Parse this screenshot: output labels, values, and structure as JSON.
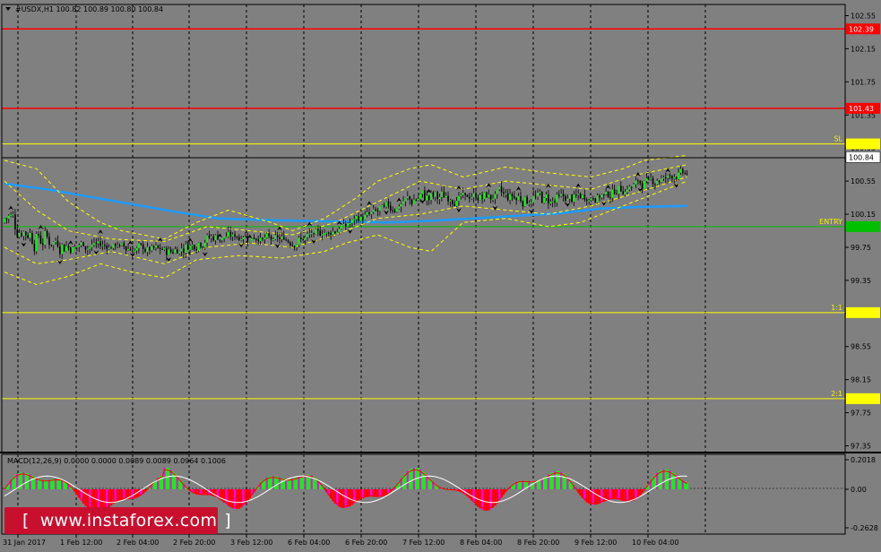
{
  "window": {
    "symbol_title": "#USDX,H1  100.82 100.89 100.80 100.84",
    "macd_title": "MACD(12,26,9) 0.0000 0.0000 0.0089 0.0089 0.0964 0.1006"
  },
  "watermark": {
    "open": "[",
    "text": "www.instaforex.com",
    "close": "]"
  },
  "colors": {
    "background": "#808080",
    "grid": "#000000",
    "bull_candle": "#00ff00",
    "bear_candle": "#000000",
    "ma": "#1e9bff",
    "envelope": "#ffff00",
    "resistance": "#ff0000",
    "level": "#ffff00",
    "entry": "#00c000",
    "macd_line": "#ff0000",
    "signal_line": "#ffffff",
    "hist_up": "#00ff00",
    "hist_down": "#ff0000",
    "hist_mid": "#ff00ff"
  },
  "chart_data": [
    {
      "type": "candlestick",
      "title": "#USDX,H1  100.82 100.89 100.80 100.84",
      "symbol": "#USDX",
      "timeframe": "H1",
      "ohlc_last": {
        "open": 100.82,
        "high": 100.89,
        "low": 100.8,
        "close": 100.84
      },
      "y_ticks": [
        102.55,
        102.15,
        101.75,
        101.35,
        100.95,
        100.55,
        100.15,
        99.75,
        99.35,
        98.95,
        98.55,
        98.15,
        97.75,
        97.35
      ],
      "x_ticks": [
        "31 Jan 2017",
        "1 Feb 12:00",
        "2 Feb 04:00",
        "2 Feb 20:00",
        "3 Feb 12:00",
        "6 Feb 04:00",
        "6 Feb 20:00",
        "7 Feb 12:00",
        "8 Feb 04:00",
        "8 Feb 20:00",
        "9 Feb 12:00",
        "10 Feb 04:00"
      ],
      "ylim": [
        97.25,
        102.65
      ],
      "grid": true,
      "levels": [
        {
          "name": "r2",
          "value": 102.39,
          "label": "",
          "badge": "102.39",
          "color": "#ff0000"
        },
        {
          "name": "r1",
          "value": 101.43,
          "label": "",
          "badge": "101.43",
          "color": "#ff0000"
        },
        {
          "name": "sl",
          "value": 101.0,
          "label": "SL",
          "badge": "",
          "color": "#ffff00"
        },
        {
          "name": "entry",
          "value": 100.0,
          "label": "ENTRY",
          "badge": "",
          "color": "#00c000"
        },
        {
          "name": "tp1",
          "value": 98.96,
          "label": "1:1",
          "badge": "",
          "color": "#ffff00"
        },
        {
          "name": "tp2",
          "value": 97.92,
          "label": "2:1",
          "badge": "",
          "color": "#ffff00"
        }
      ],
      "current_price": {
        "value": 100.84,
        "badge": "100.84"
      },
      "series": [
        {
          "kind": "moving_average",
          "points": [
            [
              0,
              100.52
            ],
            [
              20,
              100.45
            ],
            [
              40,
              100.36
            ],
            [
              60,
              100.27
            ],
            [
              80,
              100.18
            ],
            [
              100,
              100.1
            ],
            [
              120,
              100.08
            ],
            [
              140,
              100.07
            ],
            [
              160,
              100.06
            ],
            [
              180,
              100.05
            ],
            [
              200,
              100.07
            ],
            [
              220,
              100.1
            ],
            [
              240,
              100.13
            ],
            [
              260,
              100.16
            ],
            [
              280,
              100.22
            ],
            [
              300,
              100.24
            ],
            [
              320,
              100.25
            ]
          ]
        },
        {
          "kind": "envelope_upper",
          "points": [
            [
              0,
              100.8
            ],
            [
              15,
              100.7
            ],
            [
              30,
              100.3
            ],
            [
              45,
              100.05
            ],
            [
              55,
              99.95
            ],
            [
              75,
              99.85
            ],
            [
              90,
              100.05
            ],
            [
              105,
              100.2
            ],
            [
              125,
              100.05
            ],
            [
              135,
              99.95
            ],
            [
              150,
              100.1
            ],
            [
              165,
              100.35
            ],
            [
              175,
              100.55
            ],
            [
              190,
              100.7
            ],
            [
              200,
              100.75
            ],
            [
              215,
              100.6
            ],
            [
              235,
              100.72
            ],
            [
              255,
              100.65
            ],
            [
              275,
              100.6
            ],
            [
              290,
              100.7
            ],
            [
              300,
              100.8
            ],
            [
              320,
              100.86
            ]
          ]
        },
        {
          "kind": "envelope_lower",
          "points": [
            [
              0,
              99.45
            ],
            [
              15,
              99.3
            ],
            [
              30,
              99.4
            ],
            [
              45,
              99.55
            ],
            [
              60,
              99.45
            ],
            [
              75,
              99.38
            ],
            [
              90,
              99.6
            ],
            [
              110,
              99.65
            ],
            [
              130,
              99.62
            ],
            [
              150,
              99.7
            ],
            [
              160,
              99.8
            ],
            [
              175,
              99.9
            ],
            [
              190,
              99.75
            ],
            [
              200,
              99.7
            ],
            [
              215,
              100.05
            ],
            [
              235,
              100.1
            ],
            [
              255,
              100.0
            ],
            [
              270,
              100.05
            ],
            [
              285,
              100.2
            ],
            [
              300,
              100.35
            ],
            [
              320,
              100.55
            ]
          ]
        },
        {
          "kind": "envelope_mid_upper",
          "points": [
            [
              0,
              100.55
            ],
            [
              15,
              100.2
            ],
            [
              30,
              99.95
            ],
            [
              50,
              99.85
            ],
            [
              75,
              99.82
            ],
            [
              95,
              100.0
            ],
            [
              115,
              99.95
            ],
            [
              135,
              99.9
            ],
            [
              155,
              100.05
            ],
            [
              175,
              100.3
            ],
            [
              195,
              100.55
            ],
            [
              215,
              100.45
            ],
            [
              235,
              100.55
            ],
            [
              255,
              100.5
            ],
            [
              275,
              100.45
            ],
            [
              295,
              100.62
            ],
            [
              320,
              100.75
            ]
          ]
        },
        {
          "kind": "envelope_mid_lower",
          "points": [
            [
              0,
              99.75
            ],
            [
              15,
              99.55
            ],
            [
              30,
              99.6
            ],
            [
              50,
              99.7
            ],
            [
              75,
              99.55
            ],
            [
              95,
              99.75
            ],
            [
              115,
              99.8
            ],
            [
              135,
              99.75
            ],
            [
              155,
              99.9
            ],
            [
              175,
              100.1
            ],
            [
              195,
              100.15
            ],
            [
              215,
              100.25
            ],
            [
              235,
              100.2
            ],
            [
              255,
              100.15
            ],
            [
              275,
              100.25
            ],
            [
              295,
              100.4
            ],
            [
              320,
              100.6
            ]
          ]
        }
      ]
    },
    {
      "type": "bar",
      "title": "MACD(12,26,9) 0.0000 0.0000 0.0089 0.0089 0.0964 0.1006",
      "indicator": "MACD(12,26,9)",
      "values_shown": [
        0.0,
        0.0,
        0.0089,
        0.0089,
        0.0964,
        0.1006
      ],
      "y_ticks": [
        0.2018,
        0.0,
        -0.2628
      ],
      "ylim": [
        -0.3,
        0.24
      ]
    }
  ]
}
